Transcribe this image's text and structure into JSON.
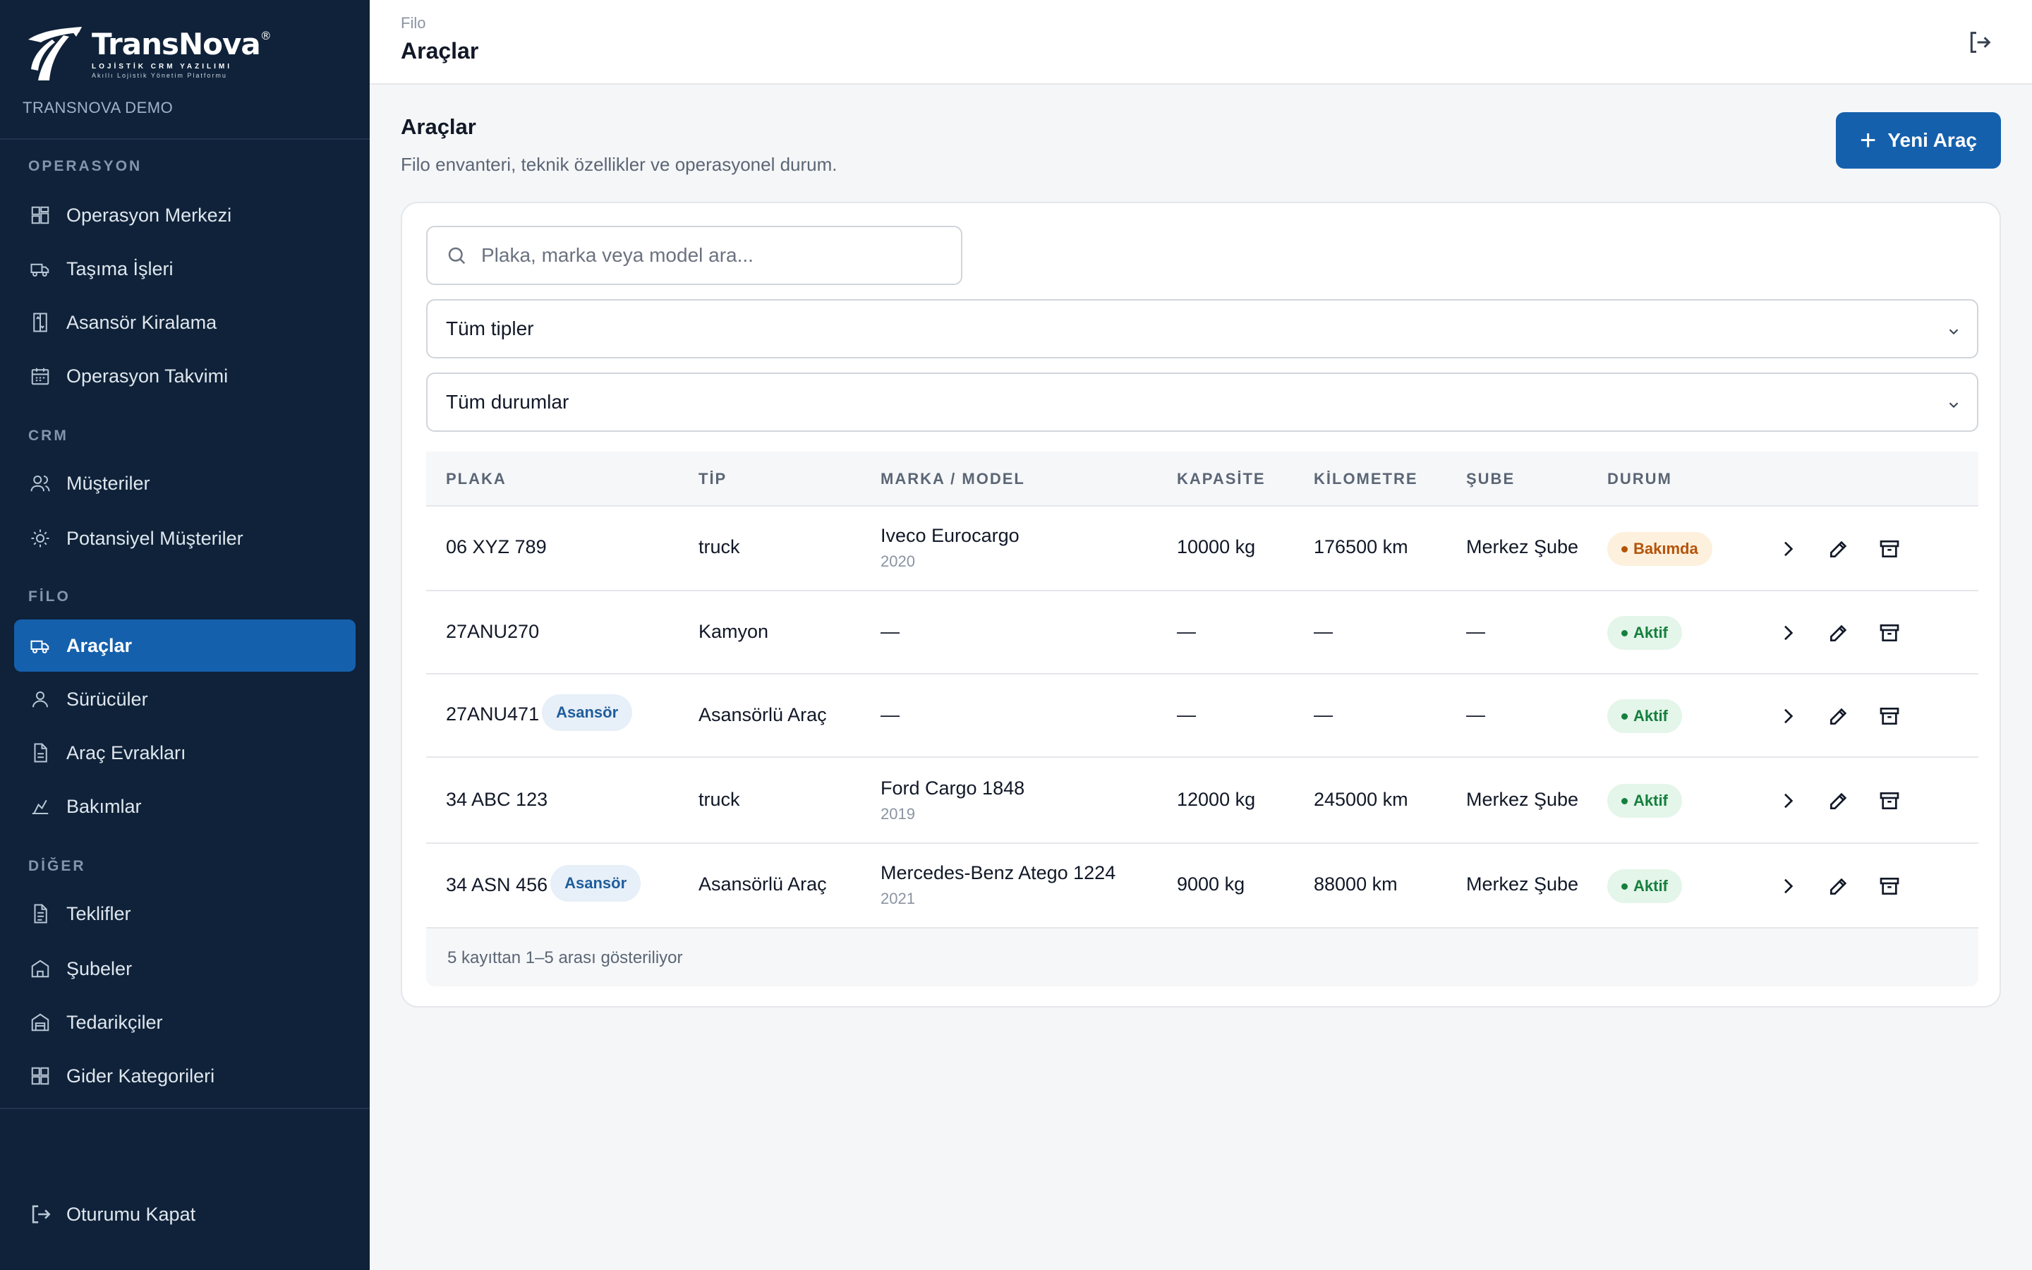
{
  "brand": {
    "name": "TransNova",
    "registered": "®",
    "tagline": "LOJİSTİK CRM YAZILIMI",
    "subline": "Akıllı Lojistik Yönetim Platformu",
    "org": "TRANSNOVA DEMO"
  },
  "sidebar": {
    "sections": [
      {
        "title": "OPERASYON"
      },
      {
        "title": "CRM"
      },
      {
        "title": "FİLO"
      },
      {
        "title": "DİĞER"
      }
    ],
    "items": [
      {
        "label": "Operasyon Merkezi",
        "icon": "dashboard-icon"
      },
      {
        "label": "Taşıma İşleri",
        "icon": "truck-icon"
      },
      {
        "label": "Asansör Kiralama",
        "icon": "elevator-icon"
      },
      {
        "label": "Operasyon Takvimi",
        "icon": "calendar-icon"
      },
      {
        "label": "Müşteriler",
        "icon": "users-icon"
      },
      {
        "label": "Potansiyel Müşteriler",
        "icon": "sun-icon"
      },
      {
        "label": "Araçlar",
        "icon": "truck-icon",
        "active": true
      },
      {
        "label": "Sürücüler",
        "icon": "user-icon"
      },
      {
        "label": "Araç Evrakları",
        "icon": "document-icon"
      },
      {
        "label": "Bakımlar",
        "icon": "maintenance-icon"
      },
      {
        "label": "Teklifler",
        "icon": "file-text-icon"
      },
      {
        "label": "Şubeler",
        "icon": "building-icon"
      },
      {
        "label": "Tedarikçiler",
        "icon": "warehouse-icon"
      },
      {
        "label": "Gider Kategorileri",
        "icon": "grid-icon"
      }
    ],
    "logout_label": "Oturumu Kapat"
  },
  "header": {
    "breadcrumb": "Filo",
    "title": "Araçlar"
  },
  "main": {
    "title": "Araçlar",
    "subtitle": "Filo envanteri, teknik özellikler ve operasyonel durum.",
    "new_button": "Yeni Araç",
    "search_placeholder": "Plaka, marka veya model ara...",
    "type_filter": "Tüm tipler",
    "status_filter": "Tüm durumlar",
    "columns": [
      "PLAKA",
      "TİP",
      "MARKA / MODEL",
      "KAPASİTE",
      "KİLOMETRE",
      "ŞUBE",
      "DURUM"
    ],
    "rows": [
      {
        "plate": "06 XYZ 789",
        "tag": "",
        "type": "truck",
        "model": "Iveco Eurocargo",
        "year": "2020",
        "capacity": "10000 kg",
        "km": "176500 km",
        "branch": "Merkez Şube",
        "status": "Bakımda",
        "status_kind": "warn"
      },
      {
        "plate": "27ANU270",
        "tag": "",
        "type": "Kamyon",
        "model": "—",
        "year": "",
        "capacity": "—",
        "km": "—",
        "branch": "—",
        "status": "Aktif",
        "status_kind": "ok"
      },
      {
        "plate": "27ANU471",
        "tag": "Asansör",
        "type": "Asansörlü Araç",
        "model": "—",
        "year": "",
        "capacity": "—",
        "km": "—",
        "branch": "—",
        "status": "Aktif",
        "status_kind": "ok"
      },
      {
        "plate": "34 ABC 123",
        "tag": "",
        "type": "truck",
        "model": "Ford Cargo 1848",
        "year": "2019",
        "capacity": "12000 kg",
        "km": "245000 km",
        "branch": "Merkez Şube",
        "status": "Aktif",
        "status_kind": "ok"
      },
      {
        "plate": "34 ASN 456",
        "tag": "Asansör",
        "type": "Asansörlü Araç",
        "model": "Mercedes-Benz Atego 1224",
        "year": "2021",
        "capacity": "9000 kg",
        "km": "88000 km",
        "branch": "Merkez Şube",
        "status": "Aktif",
        "status_kind": "ok"
      }
    ],
    "footer": "5 kayıttan 1–5 arası gösteriliyor"
  },
  "colors": {
    "sidebar_bg": "#0f2239",
    "accent": "#1560ad",
    "warn": "#b45309",
    "ok": "#15803d"
  }
}
